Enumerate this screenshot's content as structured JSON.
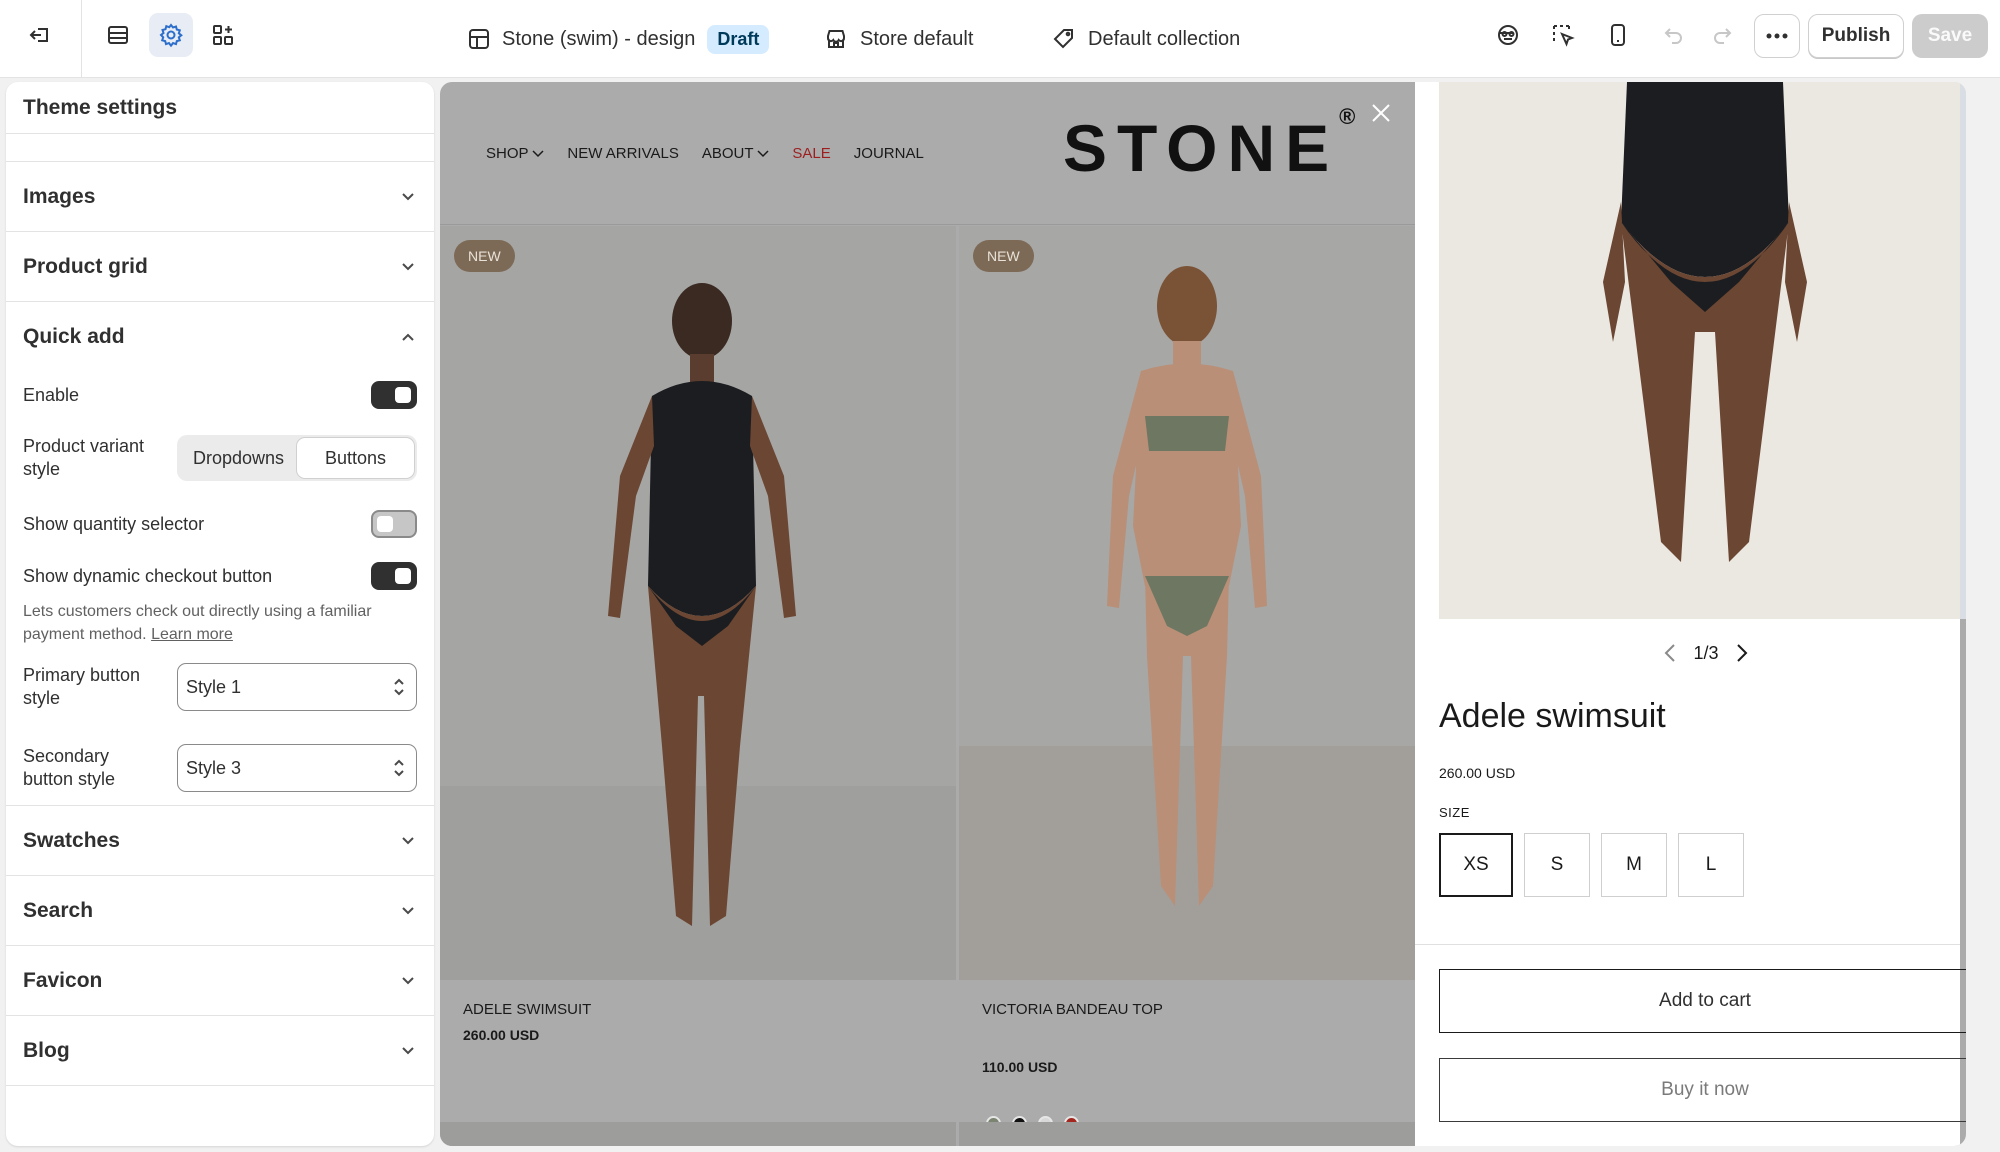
{
  "topbar": {
    "theme_name": "Stone (swim) - design",
    "theme_status": "Draft",
    "store_label": "Store default",
    "collection_label": "Default collection",
    "publish_label": "Publish",
    "save_label": "Save"
  },
  "panel": {
    "title": "Theme settings",
    "sections": {
      "images": "Images",
      "product_grid": "Product grid",
      "quick_add": "Quick add",
      "swatches": "Swatches",
      "search": "Search",
      "favicon": "Favicon",
      "blog": "Blog"
    },
    "quick_add": {
      "enable_label": "Enable",
      "enable_value": true,
      "variant_style_label": "Product variant style",
      "variant_options": [
        "Dropdowns",
        "Buttons"
      ],
      "variant_selected": "Buttons",
      "show_quantity_label": "Show quantity selector",
      "show_quantity_value": false,
      "dynamic_checkout_label": "Show dynamic checkout button",
      "dynamic_checkout_value": true,
      "dynamic_checkout_help": "Lets customers check out directly using a familiar payment method.",
      "learn_more": "Learn more",
      "primary_label": "Primary button style",
      "primary_value": "Style 1",
      "secondary_label": "Secondary button style",
      "secondary_value": "Style 3"
    }
  },
  "preview": {
    "nav": [
      "SHOP",
      "NEW ARRIVALS",
      "ABOUT",
      "SALE",
      "JOURNAL"
    ],
    "logo": "STONE",
    "logo_mark": "®",
    "products": [
      {
        "badge": "NEW",
        "name": "ADELE SWIMSUIT",
        "price": "260.00 USD"
      },
      {
        "badge": "NEW",
        "name": "VICTORIA BANDEAU TOP",
        "price": "110.00 USD",
        "swatches": [
          "#7b8470",
          "#111111",
          "#d8d8d8",
          "#a3271e"
        ]
      }
    ],
    "quick_add": {
      "pager": "1/3",
      "title": "Adele swimsuit",
      "price": "260.00 USD",
      "size_label": "SIZE",
      "sizes": [
        "XS",
        "S",
        "M",
        "L"
      ],
      "selected_size": "XS",
      "add_to_cart": "Add to cart",
      "buy_now": "Buy it now"
    }
  },
  "colors": {
    "accent_selected": "#e8ecf4",
    "draft_badge": "#d5ebff",
    "sale_red": "#9c1f1f",
    "badge_new": "#7d6a56"
  }
}
